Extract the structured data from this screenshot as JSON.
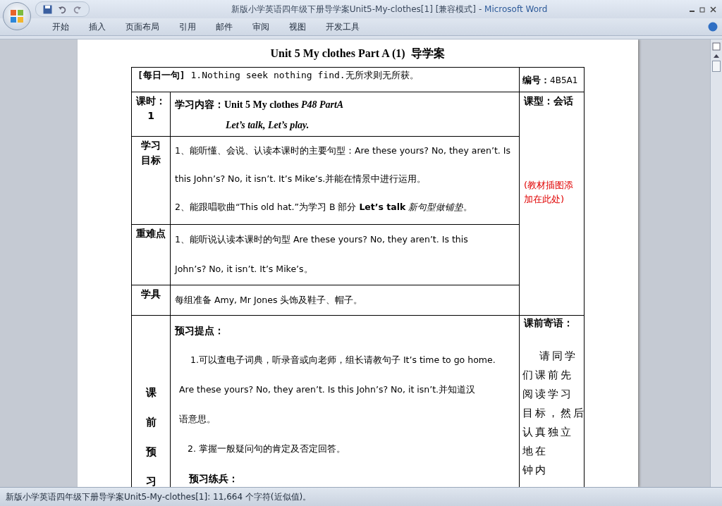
{
  "window": {
    "title": "新版小学英语四年级下册导学案Unit5-My-clothes[1] [兼容模式]",
    "separator": "-",
    "app": "Microsoft Word"
  },
  "ribbon_tabs": [
    "开始",
    "插入",
    "页面布局",
    "引用",
    "邮件",
    "审阅",
    "视图",
    "开发工具"
  ],
  "document": {
    "heading": "Unit 5 My clothes Part A (1)",
    "heading_cn": "导学案",
    "daily_sentence": {
      "label": "[每日一句]",
      "text": "1.Nothing seek nothing find.无所求则无所获。"
    },
    "code": {
      "label": "编号：",
      "value": "4B5A1"
    },
    "rows": [
      {
        "label": "课时：",
        "label_2": "1",
        "kind": "plain",
        "lines": [
          "学习内容：Unit 5 My clothes *P48 PartA*"
        ],
        "lines_2": [
          "*Let’s talk, Let’s play.*"
        ]
      },
      {
        "label": "学习",
        "label_2": "目标",
        "kind": "plain",
        "lines": [
          "1、能听懂、会说、认读本课时的主要句型：Are these yours? No, they aren’t. Is",
          "this John’s? No, it isn’t. It’s Mike’s.并能在情景中进行运用。",
          "2、能跟唱歌曲“This old hat.”为学习 B 部分 **Let’s talk** *新句型做铺垫*。"
        ]
      },
      {
        "label": "重难点",
        "kind": "plain",
        "lines": [
          "1、能听说认读本课时的句型 Are these yours? No, they aren’t. Is this",
          "John’s? No, it isn’t. It’s Mike’s。"
        ]
      },
      {
        "label": "学具",
        "kind": "plain",
        "lines": [
          "每组准备 Amy, Mr Jones 头饰及鞋子、帽子。"
        ]
      },
      {
        "label": "课前预习",
        "kind": "vertical",
        "lines": [
          "预习提点：",
          "1.可以查电子词典，听录音或向老师，组长请教句子 It’s time to go home.",
          "Are these yours? No, they aren’t. Is this John’s? No, it isn’t.并知道汉",
          "语意思。",
          "2. 掌握一般疑问句的肯定及否定回答。",
          "预习练兵："
        ]
      }
    ],
    "lesson_type": "课型：会话",
    "picture_note": "(教材插图添加在此处)",
    "advice_title": "课前寄语：",
    "advice_lines": [
      "请同学",
      "们课前先",
      "阅读学习",
      "目标，然后",
      "认真独立",
      "地在",
      "钟内"
    ]
  },
  "status_bar": "新版小学英语四年级下册导学案Unit5-My-clothes[1]: 11,664 个字符(近似值)。"
}
